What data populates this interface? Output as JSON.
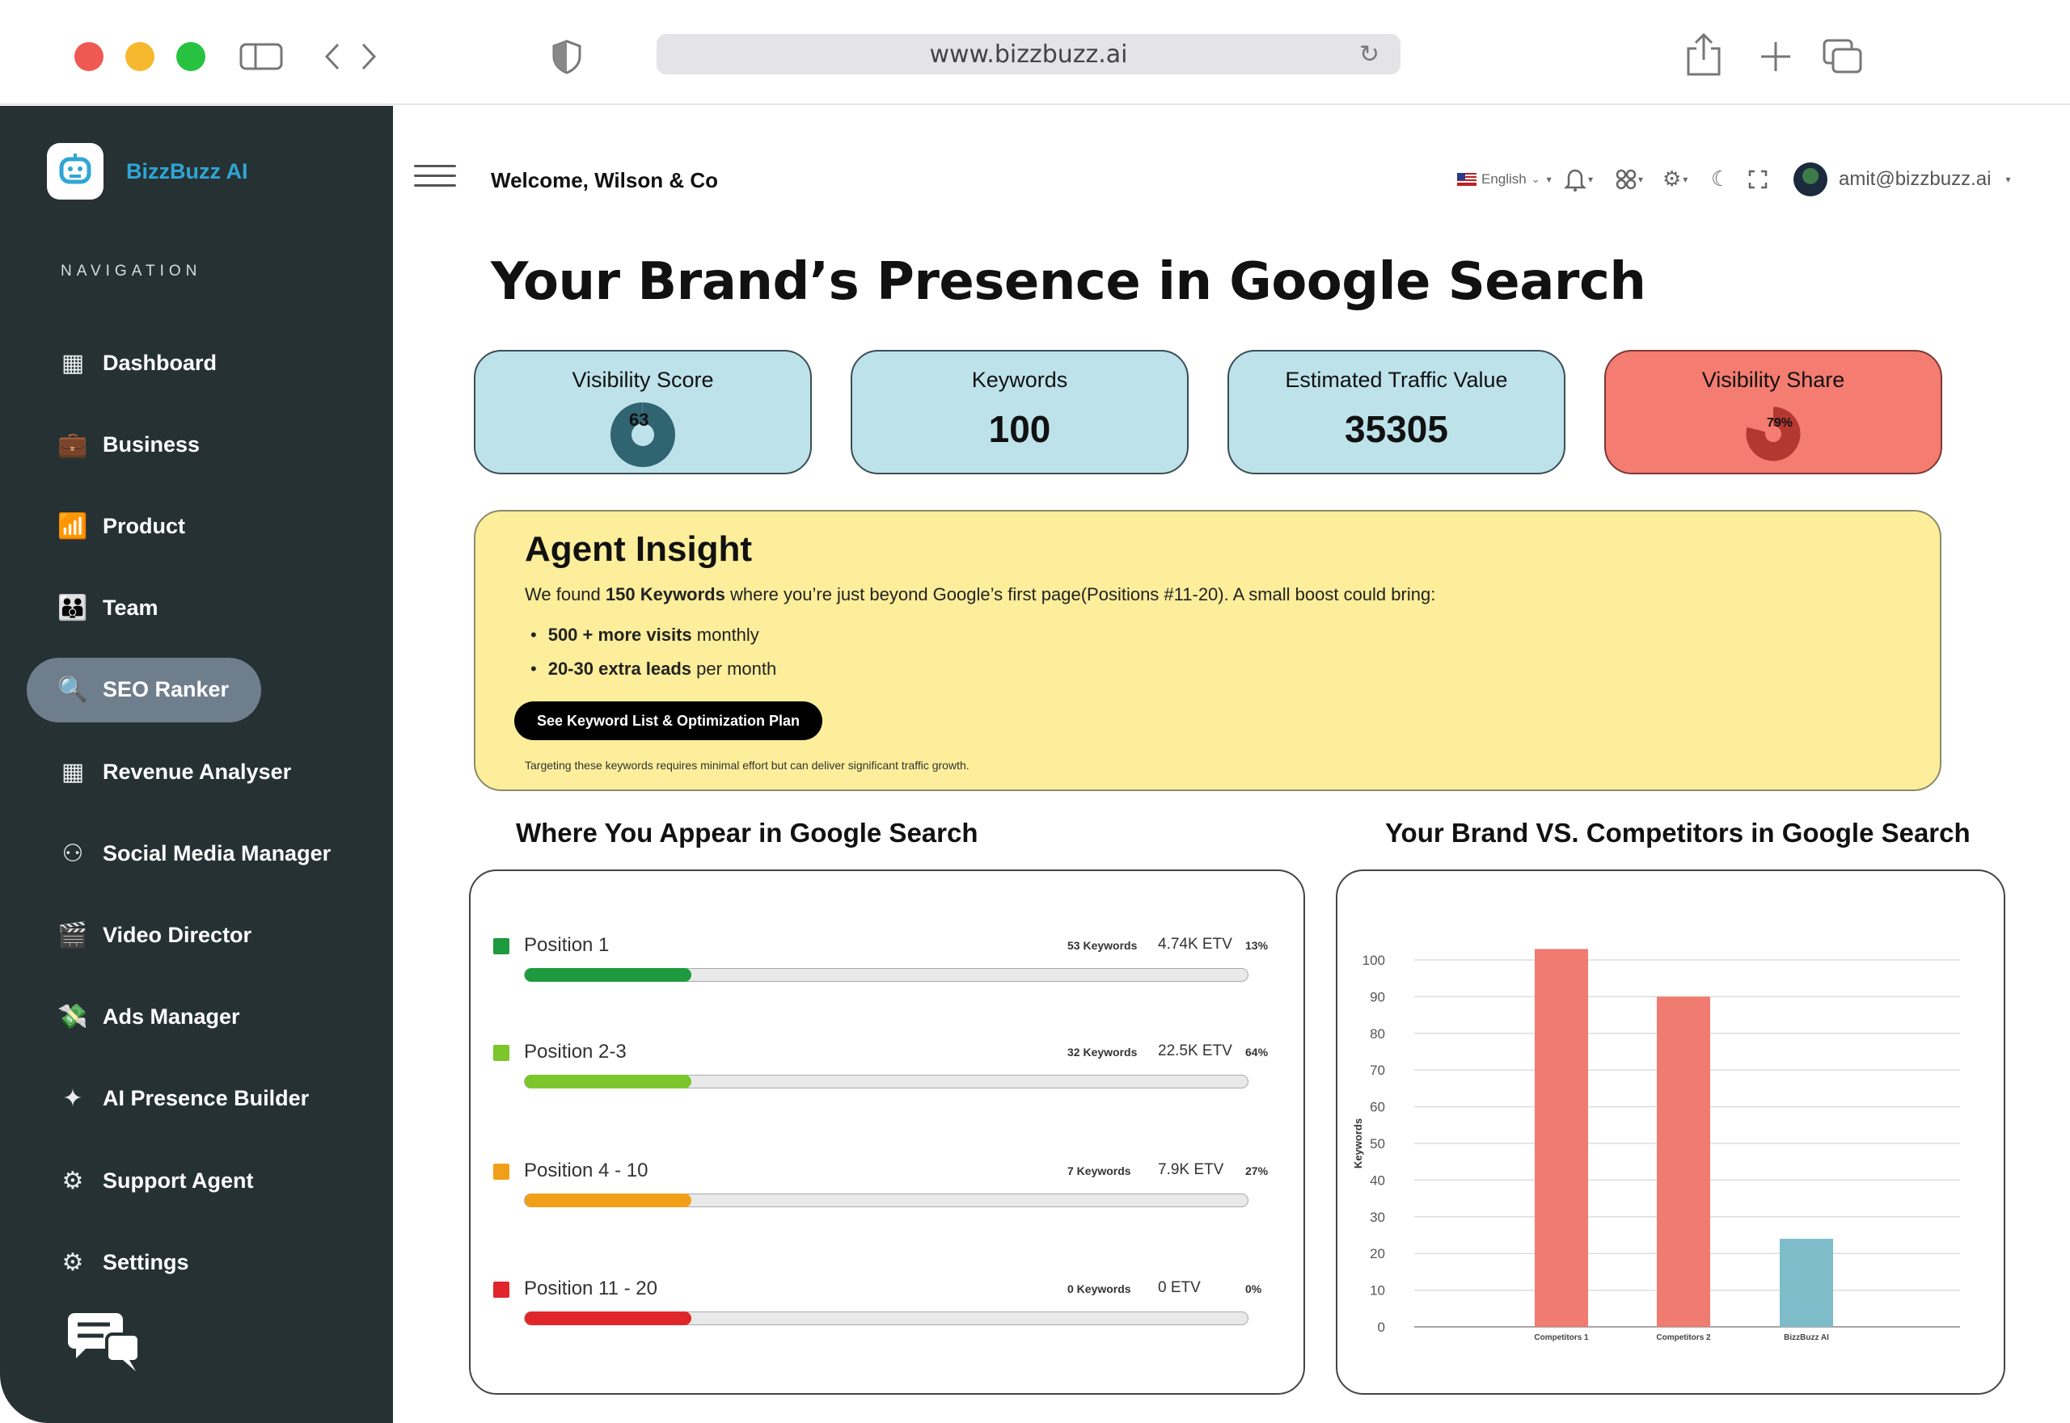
{
  "browser": {
    "url": "www.bizzbuzz.ai"
  },
  "sidebar": {
    "brand": "BizzBuzz AI",
    "heading": "NAVIGATION",
    "items": [
      {
        "label": "Dashboard",
        "icon": "dashboard-icon",
        "active": false
      },
      {
        "label": "Business",
        "icon": "briefcase-icon",
        "active": false
      },
      {
        "label": "Product",
        "icon": "growth-chart-icon",
        "active": false
      },
      {
        "label": "Team",
        "icon": "team-icon",
        "active": false
      },
      {
        "label": "SEO Ranker",
        "icon": "seo-search-icon",
        "active": true
      },
      {
        "label": "Revenue Analyser",
        "icon": "calendar-icon",
        "active": false
      },
      {
        "label": "Social Media Manager",
        "icon": "social-network-icon",
        "active": false
      },
      {
        "label": "Video Director",
        "icon": "video-director-icon",
        "active": false
      },
      {
        "label": "Ads Manager",
        "icon": "ads-icon",
        "active": false
      },
      {
        "label": "AI Presence Builder",
        "icon": "ai-sparkle-icon",
        "active": false
      },
      {
        "label": "Support Agent",
        "icon": "support-agent-icon",
        "active": false
      },
      {
        "label": "Settings",
        "icon": "gear-icon",
        "active": false
      }
    ]
  },
  "topbar": {
    "welcome": "Welcome, Wilson & Co",
    "language": "English",
    "user_email": "amit@bizzbuzz.ai"
  },
  "page": {
    "title": "Your Brand’s Presence in Google Search"
  },
  "kpis": {
    "visibility_score": {
      "title": "Visibility Score",
      "value": "63",
      "fraction": 0.63
    },
    "keywords": {
      "title": "Keywords",
      "value": "100"
    },
    "traffic_value": {
      "title": "Estimated Traffic Value",
      "value": "35305"
    },
    "visibility_share": {
      "title": "Visibility Share",
      "value": "79%",
      "fraction": 0.79
    }
  },
  "insight": {
    "title": "Agent Insight",
    "lead_pre": "We found ",
    "lead_bold": "150 Keywords",
    "lead_post": " where you’re just beyond Google’s first page(Positions #11-20). A small boost could bring:",
    "bullets": [
      {
        "bold": "500 + more visits",
        "rest": " monthly"
      },
      {
        "bold": "20-30 extra leads",
        "rest": " per month"
      }
    ],
    "button": "See Keyword List & Optimization Plan",
    "note": "Targeting these keywords requires minimal effort but can deliver significant traffic growth."
  },
  "positions": {
    "title": "Where You Appear in Google Search",
    "rows": [
      {
        "label": "Position 1",
        "keywords": "53 Keywords",
        "etv": "4.74K ETV",
        "pct": "13%",
        "color": "#1e9a3f",
        "fill": 0.23
      },
      {
        "label": "Position 2-3",
        "keywords": "32 Keywords",
        "etv": "22.5K ETV",
        "pct": "64%",
        "color": "#7cc62c",
        "fill": 0.23
      },
      {
        "label": "Position 4 - 10",
        "keywords": "7 Keywords",
        "etv": "7.9K ETV",
        "pct": "27%",
        "color": "#f0a018",
        "fill": 0.23
      },
      {
        "label": "Position 11 - 20",
        "keywords": "0 Keywords",
        "etv": "0 ETV",
        "pct": "0%",
        "color": "#e0262b",
        "fill": 0.23
      }
    ]
  },
  "chart_data": {
    "type": "bar",
    "title": "Your Brand VS. Competitors in Google Search",
    "ylabel": "Keywords",
    "xlabel": "",
    "categories": [
      "Competitors 1",
      "Competitors 2",
      "BizzBuzz AI"
    ],
    "values": [
      103,
      90,
      24
    ],
    "colors": [
      "#f07b70",
      "#f07b70",
      "#7fbcca"
    ],
    "ylim": [
      0,
      100
    ],
    "yticks": [
      0,
      10,
      20,
      30,
      40,
      50,
      60,
      70,
      80,
      90,
      100
    ],
    "grid": true
  }
}
